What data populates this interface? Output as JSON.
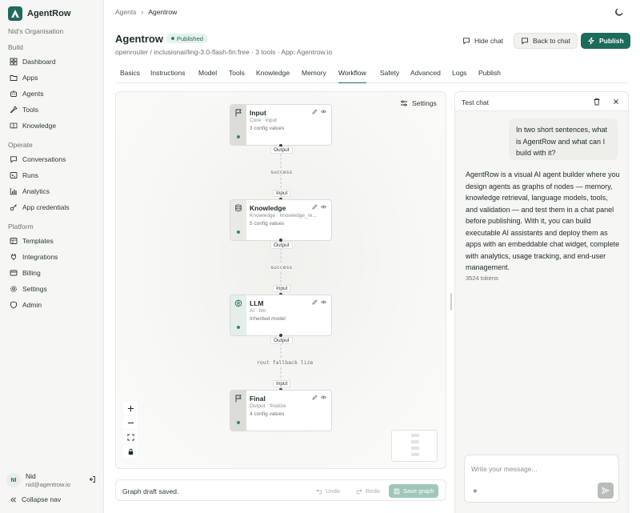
{
  "brand": {
    "name": "AgentRow"
  },
  "sidebar": {
    "org": "Nid's Organisation",
    "sections": {
      "build": "Build",
      "operate": "Operate",
      "platform": "Platform"
    },
    "build_items": [
      {
        "label": "Dashboard",
        "icon": "grid-icon"
      },
      {
        "label": "Apps",
        "icon": "folder-icon"
      },
      {
        "label": "Agents",
        "icon": "agent-icon"
      },
      {
        "label": "Tools",
        "icon": "wrench-icon"
      },
      {
        "label": "Knowledge",
        "icon": "book-icon"
      }
    ],
    "operate_items": [
      {
        "label": "Conversations",
        "icon": "chat-icon"
      },
      {
        "label": "Runs",
        "icon": "terminal-icon"
      },
      {
        "label": "Analytics",
        "icon": "chart-icon"
      },
      {
        "label": "App credentials",
        "icon": "key-icon"
      }
    ],
    "platform_items": [
      {
        "label": "Templates",
        "icon": "template-icon"
      },
      {
        "label": "Integrations",
        "icon": "plug-icon"
      },
      {
        "label": "Billing",
        "icon": "card-icon"
      },
      {
        "label": "Settings",
        "icon": "gear-icon"
      },
      {
        "label": "Admin",
        "icon": "shield-icon"
      }
    ],
    "user": {
      "initials": "NI",
      "name": "Nid",
      "email": "nid@agentrow.io"
    },
    "collapse_label": "Collapse nav"
  },
  "breadcrumb": {
    "parent": "Agents",
    "current": "Agentrow"
  },
  "header": {
    "title": "Agentrow",
    "status": "Published",
    "subtitle": "openrouter / inclusionai/ling-3.0-flash-fin:free · 3 tools · App: Agentrow.io",
    "hide_chat": "Hide chat",
    "back_to_chat": "Back to chat",
    "publish": "Publish"
  },
  "tabs": [
    "Basics",
    "Instructions",
    "Model",
    "Tools",
    "Knowledge",
    "Memory",
    "Workflow",
    "Safety",
    "Advanced",
    "Logs",
    "Publish"
  ],
  "active_tab": "Workflow",
  "canvas": {
    "settings_label": "Settings",
    "nodes": [
      {
        "title": "Input",
        "type": "Core · input",
        "config": "3 config values",
        "icon": "flag-icon"
      },
      {
        "title": "Knowledge",
        "type": "Knowledge · knowledge_re...",
        "config": "5 config values",
        "icon": "database-icon"
      },
      {
        "title": "LLM",
        "type": "AI · llm",
        "config": "Inherited model",
        "icon": "brain-icon"
      },
      {
        "title": "Final",
        "type": "Output · finalize",
        "config": "4 config values",
        "icon": "flag-icon"
      }
    ],
    "ports": {
      "output": "Output",
      "input": "Input"
    },
    "edges": [
      "success",
      "success",
      "rout fallback lize"
    ]
  },
  "statusbar": {
    "message": "Graph draft saved.",
    "undo": "Undo",
    "redo": "Redo",
    "save": "Save graph"
  },
  "chat": {
    "title": "Test chat",
    "user_message": "In two short sentences, what is AgentRow and what can I build with it?",
    "bot_message": "AgentRow is a visual AI agent builder where you design agents as graphs of nodes — memory, knowledge retrieval, language models, tools, and validation — and test them in a chat panel before publishing. With it, you can build executable AI assistants and deploy them as apps with an embeddable chat widget, complete with analytics, usage tracking, and end-user management.",
    "tokens": "3524 tokens",
    "placeholder": "Write your message...",
    "plus": "+"
  },
  "colors": {
    "accent": "#1d6b5a",
    "status_dot": "#2f8a6f"
  }
}
